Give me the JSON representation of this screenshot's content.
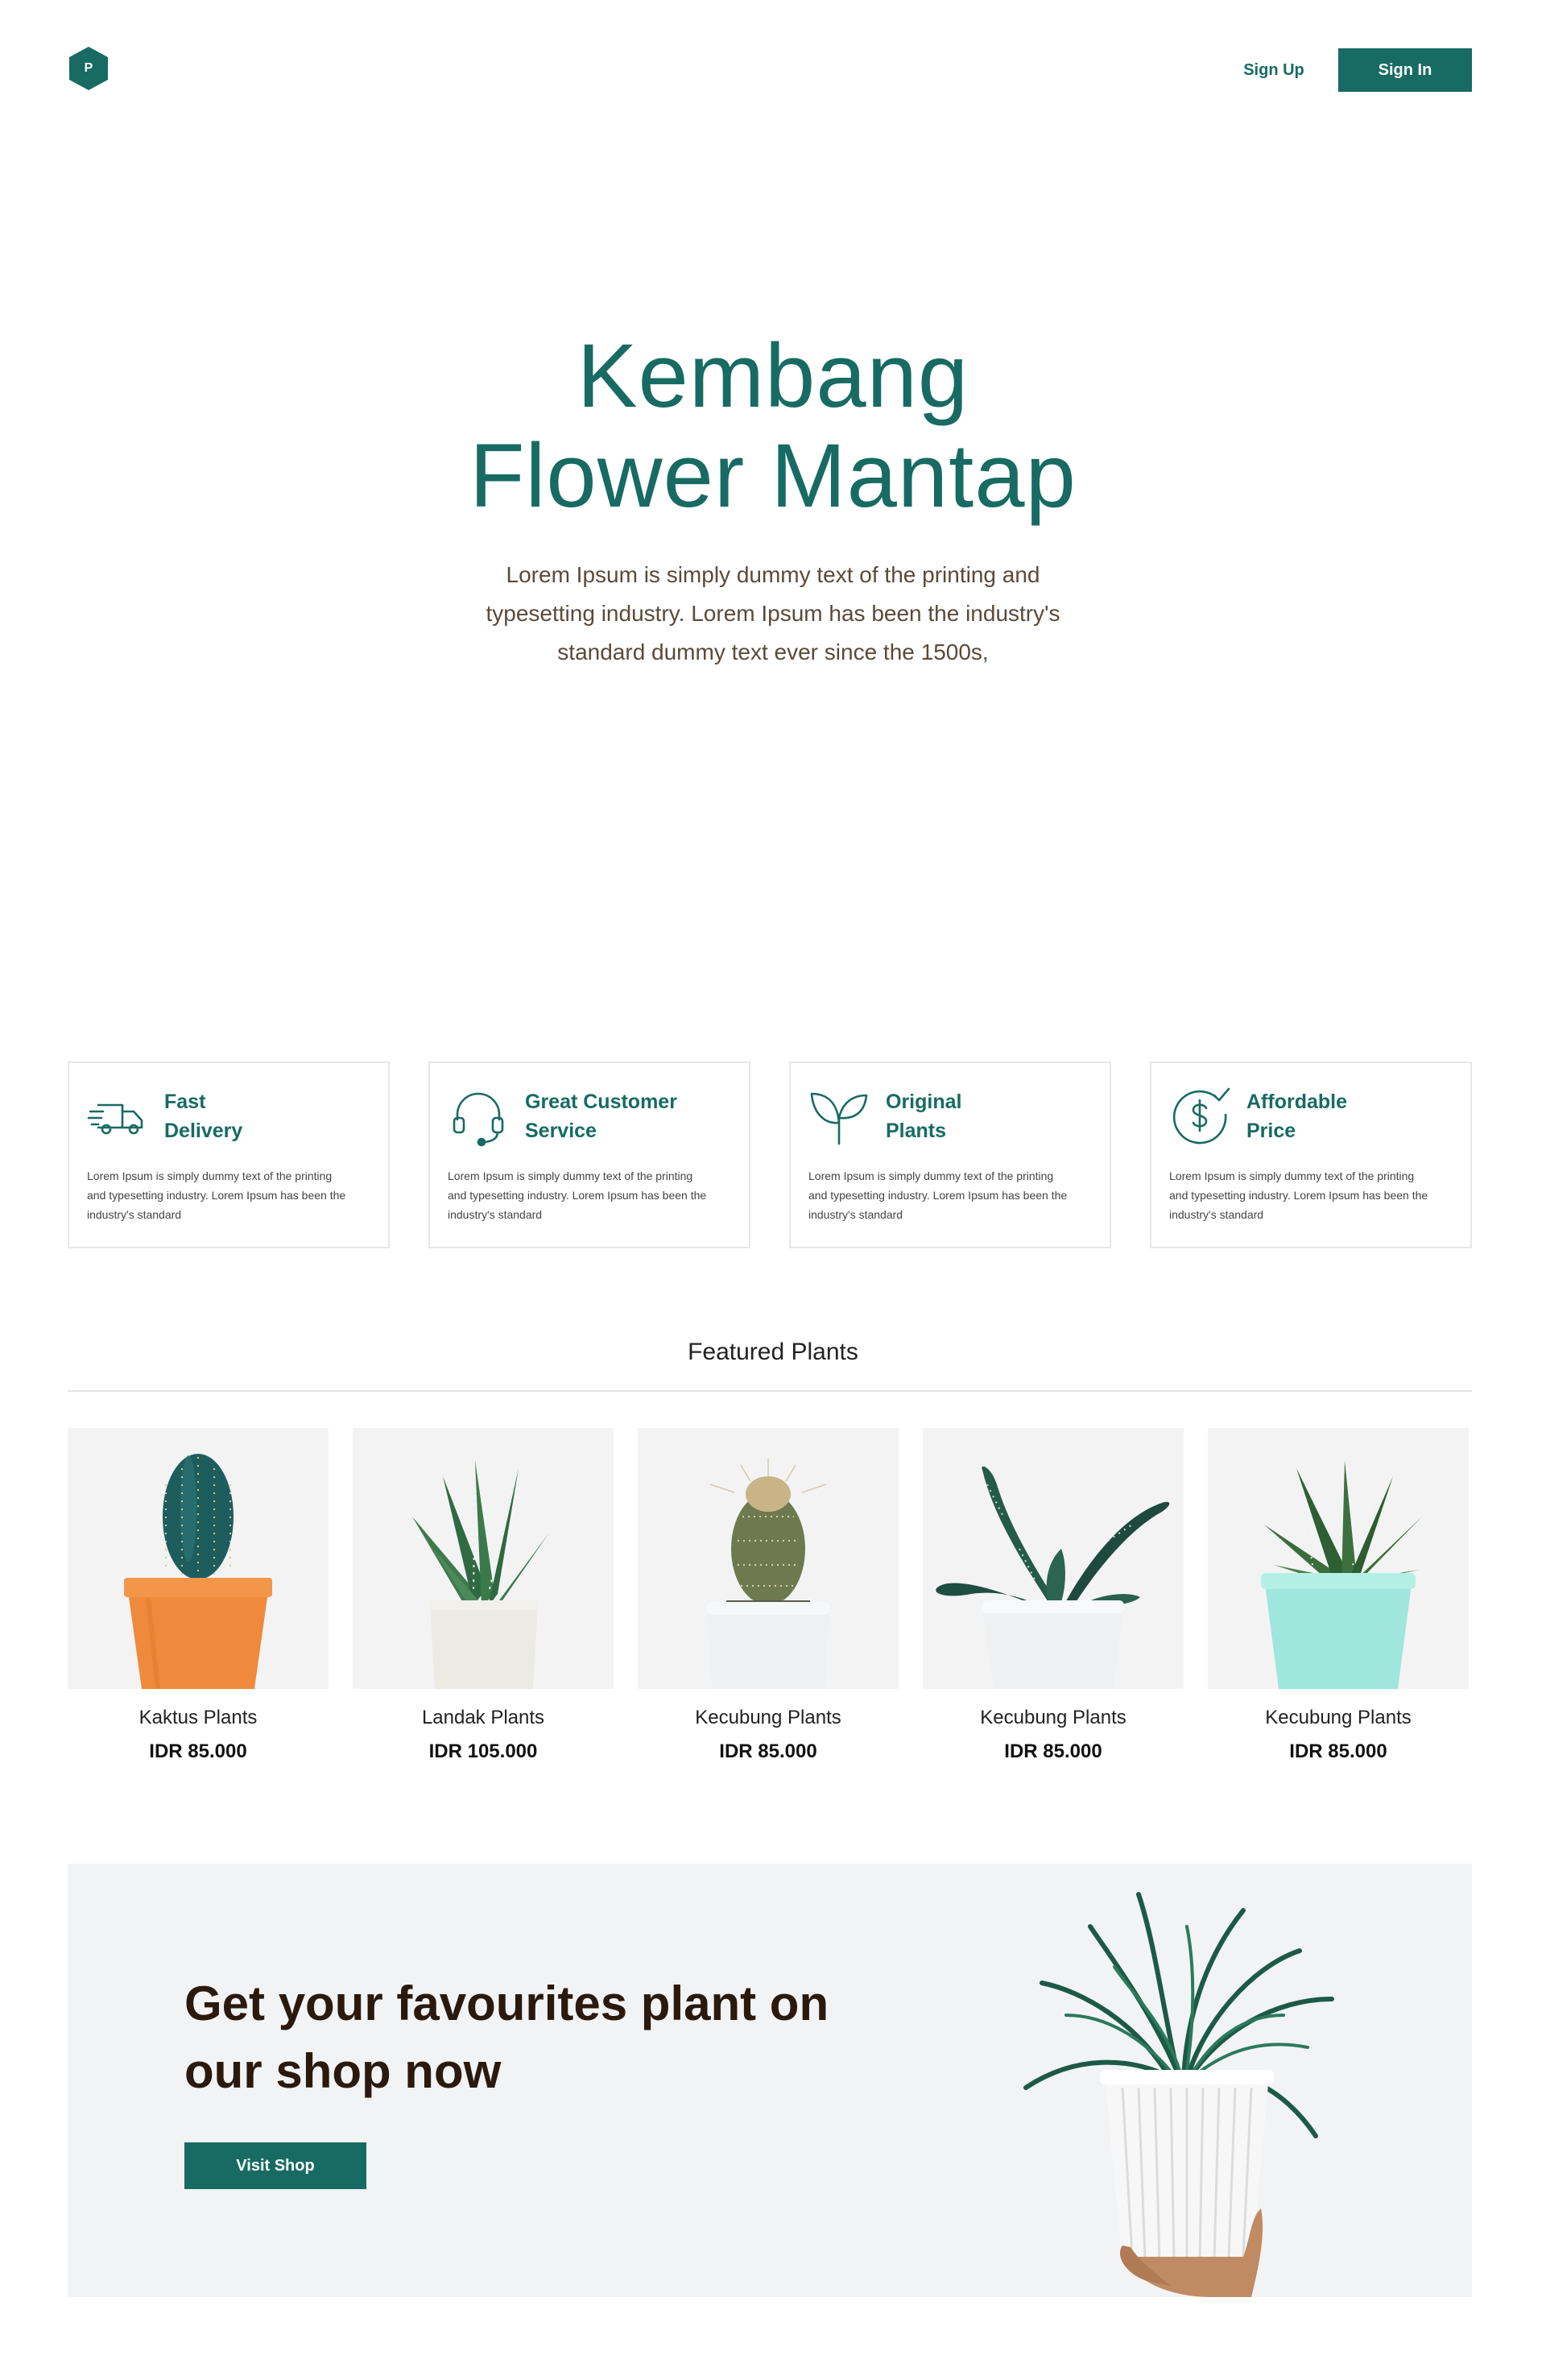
{
  "colors": {
    "brand": "#176b62",
    "cta_title": "#2a1a0e",
    "card_bg": "#f3f3f4",
    "cta_bg": "#f2f3f4"
  },
  "header": {
    "logo_letter": "P",
    "logo_icon": "hexagon-logo-icon",
    "signup_label": "Sign Up",
    "signin_label": "Sign In"
  },
  "hero": {
    "title_line1": "Kembang",
    "title_line2": "Flower Mantap",
    "description": "Lorem Ipsum is simply dummy text of the printing and typesetting industry. Lorem Ipsum has been the industry's standard dummy text ever since the 1500s,"
  },
  "features": [
    {
      "icon": "delivery-truck-icon",
      "title_line1": "Fast",
      "title_line2": "Delivery",
      "description": "Lorem Ipsum is simply dummy text of the printing and typesetting industry. Lorem Ipsum has been the industry's standard"
    },
    {
      "icon": "headset-icon",
      "title_line1": "Great Customer",
      "title_line2": "Service",
      "description": "Lorem Ipsum is simply dummy text of the printing and typesetting industry. Lorem Ipsum has been the industry's standard"
    },
    {
      "icon": "sprout-icon",
      "title_line1": "Original",
      "title_line2": "Plants",
      "description": "Lorem Ipsum is simply dummy text of the printing and typesetting industry. Lorem Ipsum has been the industry's standard"
    },
    {
      "icon": "dollar-check-icon",
      "title_line1": "Affordable",
      "title_line2": "Price",
      "description": "Lorem Ipsum is simply dummy text of the printing and typesetting industry. Lorem Ipsum has been the industry's standard"
    }
  ],
  "featured": {
    "title": "Featured Plants",
    "products": [
      {
        "name": "Kaktus Plants",
        "price": "IDR 85.000"
      },
      {
        "name": "Landak Plants",
        "price": "IDR 105.000"
      },
      {
        "name": "Kecubung Plants",
        "price": "IDR 85.000"
      },
      {
        "name": "Kecubung Plants",
        "price": "IDR 85.000"
      },
      {
        "name": "Kecubung Plants",
        "price": "IDR 85.000"
      }
    ]
  },
  "cta": {
    "title_line1": "Get your favourites plant on",
    "title_line2": "our shop now",
    "button_label": "Visit Shop"
  }
}
